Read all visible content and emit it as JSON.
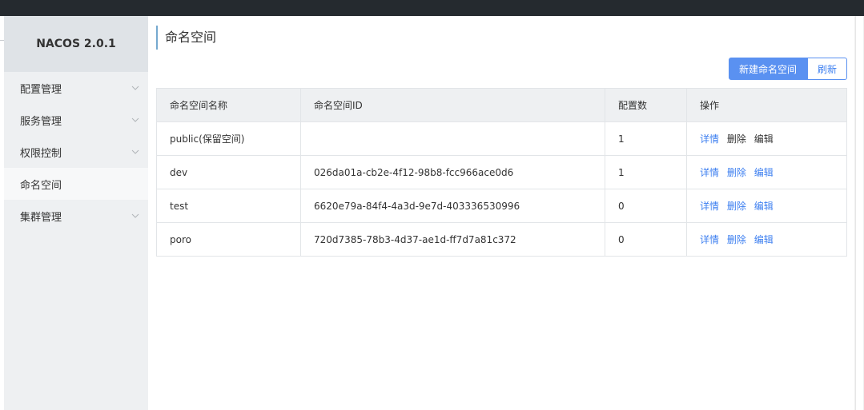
{
  "app": {
    "brand": "NACOS 2.0.1"
  },
  "sidebar": {
    "items": [
      {
        "label": "配置管理",
        "has_chevron": true
      },
      {
        "label": "服务管理",
        "has_chevron": true
      },
      {
        "label": "权限控制",
        "has_chevron": true
      },
      {
        "label": "命名空间",
        "has_chevron": false,
        "active": true
      },
      {
        "label": "集群管理",
        "has_chevron": true
      }
    ]
  },
  "main": {
    "title": "命名空间",
    "toolbar": {
      "new_label": "新建命名空间",
      "refresh_label": "刷新"
    },
    "table": {
      "headers": [
        "命名空间名称",
        "命名空间ID",
        "配置数",
        "操作"
      ],
      "rows": [
        {
          "name": "public(保留空间)",
          "id": "",
          "count": "1"
        },
        {
          "name": "dev",
          "id": "026da01a-cb2e-4f12-98b8-fcc966ace0d6",
          "count": "1"
        },
        {
          "name": "test",
          "id": "6620e79a-84f4-4a3d-9e7d-403336530996",
          "count": "0"
        },
        {
          "name": "poro",
          "id": "720d7385-78b3-4d37-ae1d-ff7d7a81c372",
          "count": "0"
        }
      ],
      "actions": {
        "detail": "详情",
        "delete": "删除",
        "edit": "编辑"
      }
    }
  },
  "colors": {
    "topbar": "#252a2f",
    "sidebar_bg": "#eef0f2",
    "brand_bg": "#dfe3e7",
    "primary": "#5a91f1",
    "link": "#3d7ff0",
    "title_bar": "#75a9cf"
  },
  "icons": {
    "menu_chevron": "chevron-down-icon"
  }
}
